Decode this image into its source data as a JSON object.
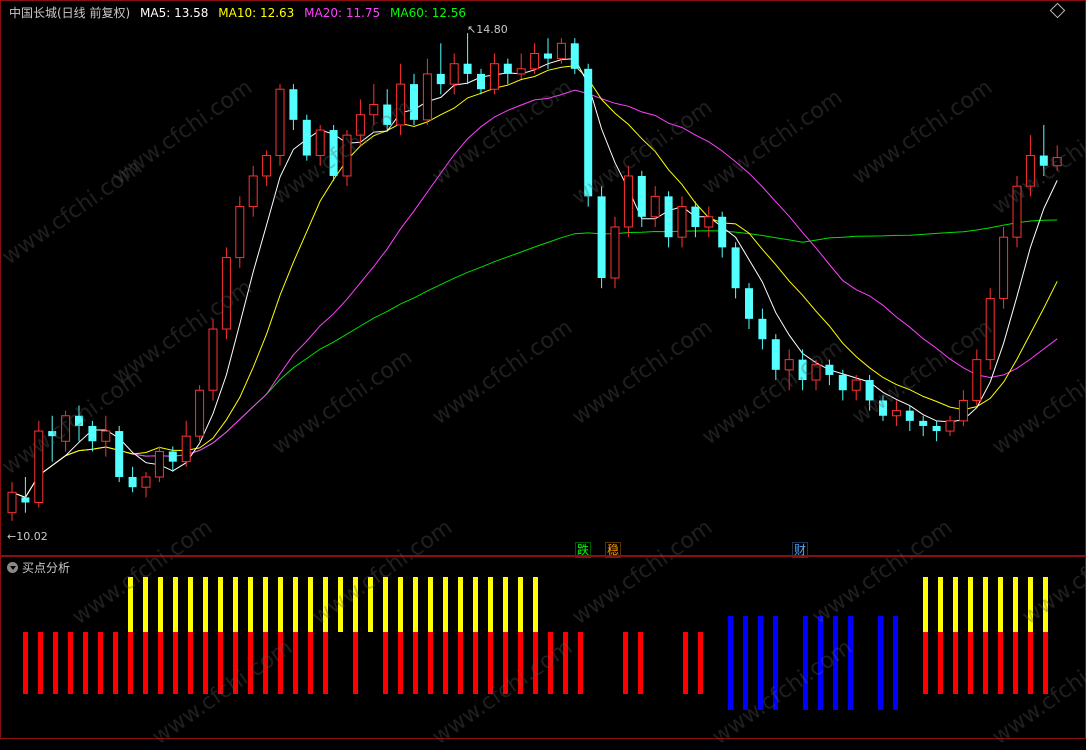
{
  "legend": {
    "title": "中国长城(日线 前复权)",
    "items": [
      {
        "label": "MA5: 13.58",
        "color": "#ffffff"
      },
      {
        "label": "MA10: 12.63",
        "color": "#ffff00"
      },
      {
        "label": "MA20: 11.75",
        "color": "#ff40ff"
      },
      {
        "label": "MA60: 12.56",
        "color": "#00ff00"
      }
    ]
  },
  "annotations": {
    "high_label": "14.80",
    "low_label": "10.02"
  },
  "markers": [
    {
      "text": "跌",
      "color": "#00ff00"
    },
    {
      "text": "稳",
      "color": "#ff9900"
    },
    {
      "text": "财",
      "color": "#4fa8ff"
    }
  ],
  "sub_panel": {
    "title": "买点分析"
  },
  "watermark": "www.cfchi.com",
  "colors": {
    "up": "#ff3232",
    "down": "#54ffff",
    "ma5": "#ffffff",
    "ma10": "#ffff00",
    "ma20": "#ff40ff",
    "ma60": "#00e000",
    "bar_red": "#ff0000",
    "bar_yellow": "#ffff00",
    "bar_blue": "#0000ff",
    "frame": "#8a1010"
  },
  "chart_data": {
    "type": "candlestick",
    "price_range": [
      10.02,
      14.8
    ],
    "candles": [
      [
        10.1,
        10.3,
        10.02,
        10.4
      ],
      [
        10.25,
        10.2,
        10.1,
        10.45
      ],
      [
        10.2,
        10.9,
        10.15,
        11.0
      ],
      [
        10.9,
        10.85,
        10.6,
        11.05
      ],
      [
        10.8,
        11.05,
        10.7,
        11.1
      ],
      [
        11.05,
        10.95,
        10.8,
        11.15
      ],
      [
        10.95,
        10.8,
        10.7,
        11.0
      ],
      [
        10.8,
        10.9,
        10.65,
        11.05
      ],
      [
        10.9,
        10.45,
        10.4,
        10.95
      ],
      [
        10.45,
        10.35,
        10.3,
        10.55
      ],
      [
        10.35,
        10.45,
        10.25,
        10.5
      ],
      [
        10.45,
        10.7,
        10.4,
        10.75
      ],
      [
        10.7,
        10.6,
        10.5,
        10.75
      ],
      [
        10.6,
        10.85,
        10.55,
        11.0
      ],
      [
        10.85,
        11.3,
        10.8,
        11.35
      ],
      [
        11.3,
        11.9,
        11.2,
        12.0
      ],
      [
        11.9,
        12.6,
        11.8,
        12.7
      ],
      [
        12.6,
        13.1,
        12.5,
        13.2
      ],
      [
        13.1,
        13.4,
        13.0,
        13.5
      ],
      [
        13.4,
        13.6,
        13.3,
        13.65
      ],
      [
        13.6,
        14.25,
        13.5,
        14.3
      ],
      [
        14.25,
        13.95,
        13.85,
        14.3
      ],
      [
        13.95,
        13.6,
        13.55,
        14.0
      ],
      [
        13.6,
        13.85,
        13.5,
        13.9
      ],
      [
        13.85,
        13.4,
        13.35,
        13.9
      ],
      [
        13.4,
        13.8,
        13.3,
        13.85
      ],
      [
        13.8,
        14.0,
        13.7,
        14.15
      ],
      [
        14.0,
        14.1,
        13.9,
        14.3
      ],
      [
        14.1,
        13.9,
        13.85,
        14.25
      ],
      [
        13.9,
        14.3,
        13.8,
        14.5
      ],
      [
        14.3,
        13.95,
        13.9,
        14.4
      ],
      [
        13.95,
        14.4,
        13.9,
        14.55
      ],
      [
        14.4,
        14.3,
        14.2,
        14.7
      ],
      [
        14.3,
        14.5,
        14.2,
        14.6
      ],
      [
        14.5,
        14.4,
        14.3,
        14.8
      ],
      [
        14.4,
        14.25,
        14.2,
        14.45
      ],
      [
        14.25,
        14.5,
        14.2,
        14.6
      ],
      [
        14.5,
        14.4,
        14.3,
        14.55
      ],
      [
        14.4,
        14.45,
        14.35,
        14.6
      ],
      [
        14.45,
        14.6,
        14.4,
        14.7
      ],
      [
        14.6,
        14.55,
        14.45,
        14.75
      ],
      [
        14.55,
        14.7,
        14.5,
        14.75
      ],
      [
        14.7,
        14.45,
        14.4,
        14.75
      ],
      [
        14.45,
        13.2,
        13.1,
        14.5
      ],
      [
        13.2,
        12.4,
        12.3,
        13.3
      ],
      [
        12.4,
        12.9,
        12.3,
        13.0
      ],
      [
        12.9,
        13.4,
        12.8,
        13.5
      ],
      [
        13.4,
        13.0,
        12.9,
        13.45
      ],
      [
        13.0,
        13.2,
        12.9,
        13.3
      ],
      [
        13.2,
        12.8,
        12.7,
        13.25
      ],
      [
        12.8,
        13.1,
        12.7,
        13.2
      ],
      [
        13.1,
        12.9,
        12.8,
        13.15
      ],
      [
        12.9,
        13.0,
        12.8,
        13.1
      ],
      [
        13.0,
        12.7,
        12.6,
        13.05
      ],
      [
        12.7,
        12.3,
        12.2,
        12.75
      ],
      [
        12.3,
        12.0,
        11.9,
        12.35
      ],
      [
        12.0,
        11.8,
        11.7,
        12.1
      ],
      [
        11.8,
        11.5,
        11.4,
        11.85
      ],
      [
        11.5,
        11.6,
        11.3,
        11.7
      ],
      [
        11.6,
        11.4,
        11.3,
        11.7
      ],
      [
        11.4,
        11.55,
        11.3,
        11.6
      ],
      [
        11.55,
        11.45,
        11.35,
        11.6
      ],
      [
        11.45,
        11.3,
        11.2,
        11.5
      ],
      [
        11.3,
        11.4,
        11.2,
        11.45
      ],
      [
        11.4,
        11.2,
        11.1,
        11.45
      ],
      [
        11.2,
        11.05,
        11.0,
        11.25
      ],
      [
        11.05,
        11.1,
        10.95,
        11.2
      ],
      [
        11.1,
        11.0,
        10.9,
        11.15
      ],
      [
        11.0,
        10.95,
        10.85,
        11.05
      ],
      [
        10.95,
        10.9,
        10.8,
        11.0
      ],
      [
        10.9,
        11.0,
        10.85,
        11.05
      ],
      [
        11.0,
        11.2,
        10.95,
        11.3
      ],
      [
        11.2,
        11.6,
        11.15,
        11.7
      ],
      [
        11.6,
        12.2,
        11.5,
        12.3
      ],
      [
        12.2,
        12.8,
        12.1,
        12.9
      ],
      [
        12.8,
        13.3,
        12.7,
        13.4
      ],
      [
        13.3,
        13.6,
        13.2,
        13.8
      ],
      [
        13.6,
        13.5,
        13.4,
        13.9
      ],
      [
        13.5,
        13.58,
        13.45,
        13.7
      ]
    ],
    "buy_analysis": [
      [
        0,
        0,
        0
      ],
      [
        1,
        0,
        0
      ],
      [
        1,
        0,
        0
      ],
      [
        1,
        0,
        0
      ],
      [
        1,
        0,
        0
      ],
      [
        1,
        0,
        0
      ],
      [
        1,
        0,
        0
      ],
      [
        1,
        0,
        0
      ],
      [
        1,
        1,
        0
      ],
      [
        1,
        1,
        0
      ],
      [
        1,
        1,
        0
      ],
      [
        1,
        1,
        0
      ],
      [
        1,
        1,
        0
      ],
      [
        1,
        1,
        0
      ],
      [
        1,
        1,
        0
      ],
      [
        1,
        1,
        0
      ],
      [
        1,
        1,
        0
      ],
      [
        1,
        1,
        0
      ],
      [
        1,
        1,
        0
      ],
      [
        1,
        1,
        0
      ],
      [
        1,
        1,
        0
      ],
      [
        1,
        1,
        0
      ],
      [
        0,
        1,
        0
      ],
      [
        1,
        1,
        0
      ],
      [
        0,
        1,
        0
      ],
      [
        1,
        1,
        0
      ],
      [
        1,
        1,
        0
      ],
      [
        1,
        1,
        0
      ],
      [
        1,
        1,
        0
      ],
      [
        1,
        1,
        0
      ],
      [
        1,
        1,
        0
      ],
      [
        1,
        1,
        0
      ],
      [
        1,
        1,
        0
      ],
      [
        1,
        1,
        0
      ],
      [
        1,
        1,
        0
      ],
      [
        1,
        1,
        0
      ],
      [
        1,
        0,
        0
      ],
      [
        1,
        0,
        0
      ],
      [
        1,
        0,
        0
      ],
      [
        0,
        0,
        0
      ],
      [
        0,
        0,
        0
      ],
      [
        1,
        0,
        0
      ],
      [
        1,
        0,
        0
      ],
      [
        0,
        0,
        0
      ],
      [
        0,
        0,
        0
      ],
      [
        1,
        0,
        0
      ],
      [
        1,
        0,
        0
      ],
      [
        0,
        0,
        0
      ],
      [
        0,
        0,
        1
      ],
      [
        0,
        0,
        1
      ],
      [
        0,
        0,
        1
      ],
      [
        0,
        0,
        1
      ],
      [
        0,
        0,
        0
      ],
      [
        0,
        0,
        1
      ],
      [
        0,
        0,
        1
      ],
      [
        0,
        0,
        1
      ],
      [
        0,
        0,
        1
      ],
      [
        0,
        0,
        0
      ],
      [
        0,
        0,
        1
      ],
      [
        0,
        0,
        1
      ],
      [
        0,
        0,
        0
      ],
      [
        1,
        1,
        0
      ],
      [
        1,
        1,
        0
      ],
      [
        1,
        1,
        0
      ],
      [
        1,
        1,
        0
      ],
      [
        1,
        1,
        0
      ],
      [
        1,
        1,
        0
      ],
      [
        1,
        1,
        0
      ],
      [
        1,
        1,
        0
      ],
      [
        1,
        1,
        0
      ]
    ]
  }
}
